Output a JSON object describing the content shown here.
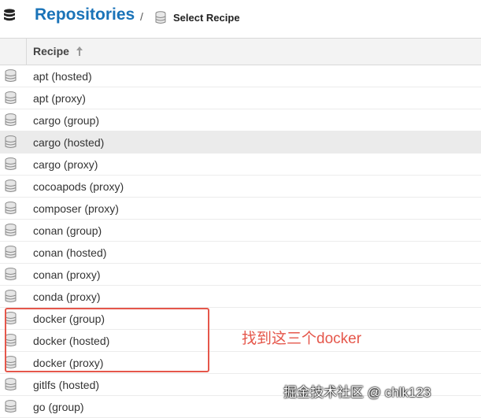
{
  "header": {
    "title": "Repositories",
    "separator": "/",
    "breadcrumb": "Select Recipe"
  },
  "table": {
    "column_header": "Recipe",
    "sort_icon": "sort-up-arrow-icon",
    "rows": [
      {
        "label": "apt (hosted)"
      },
      {
        "label": "apt (proxy)"
      },
      {
        "label": "cargo (group)"
      },
      {
        "label": "cargo (hosted)",
        "selected": true
      },
      {
        "label": "cargo (proxy)"
      },
      {
        "label": "cocoapods (proxy)"
      },
      {
        "label": "composer (proxy)"
      },
      {
        "label": "conan (group)"
      },
      {
        "label": "conan (hosted)"
      },
      {
        "label": "conan (proxy)"
      },
      {
        "label": "conda (proxy)"
      },
      {
        "label": "docker (group)"
      },
      {
        "label": "docker (hosted)"
      },
      {
        "label": "docker (proxy)"
      },
      {
        "label": "gitlfs (hosted)"
      },
      {
        "label": "go (group)"
      }
    ]
  },
  "annotation": {
    "text": "找到这三个docker",
    "color": "#e5574b"
  },
  "watermark": "掘金技术社区 @ chlk123",
  "colors": {
    "title": "#1a73b8",
    "selected_row": "#ebebeb",
    "header_bg": "#f3f3f3"
  }
}
